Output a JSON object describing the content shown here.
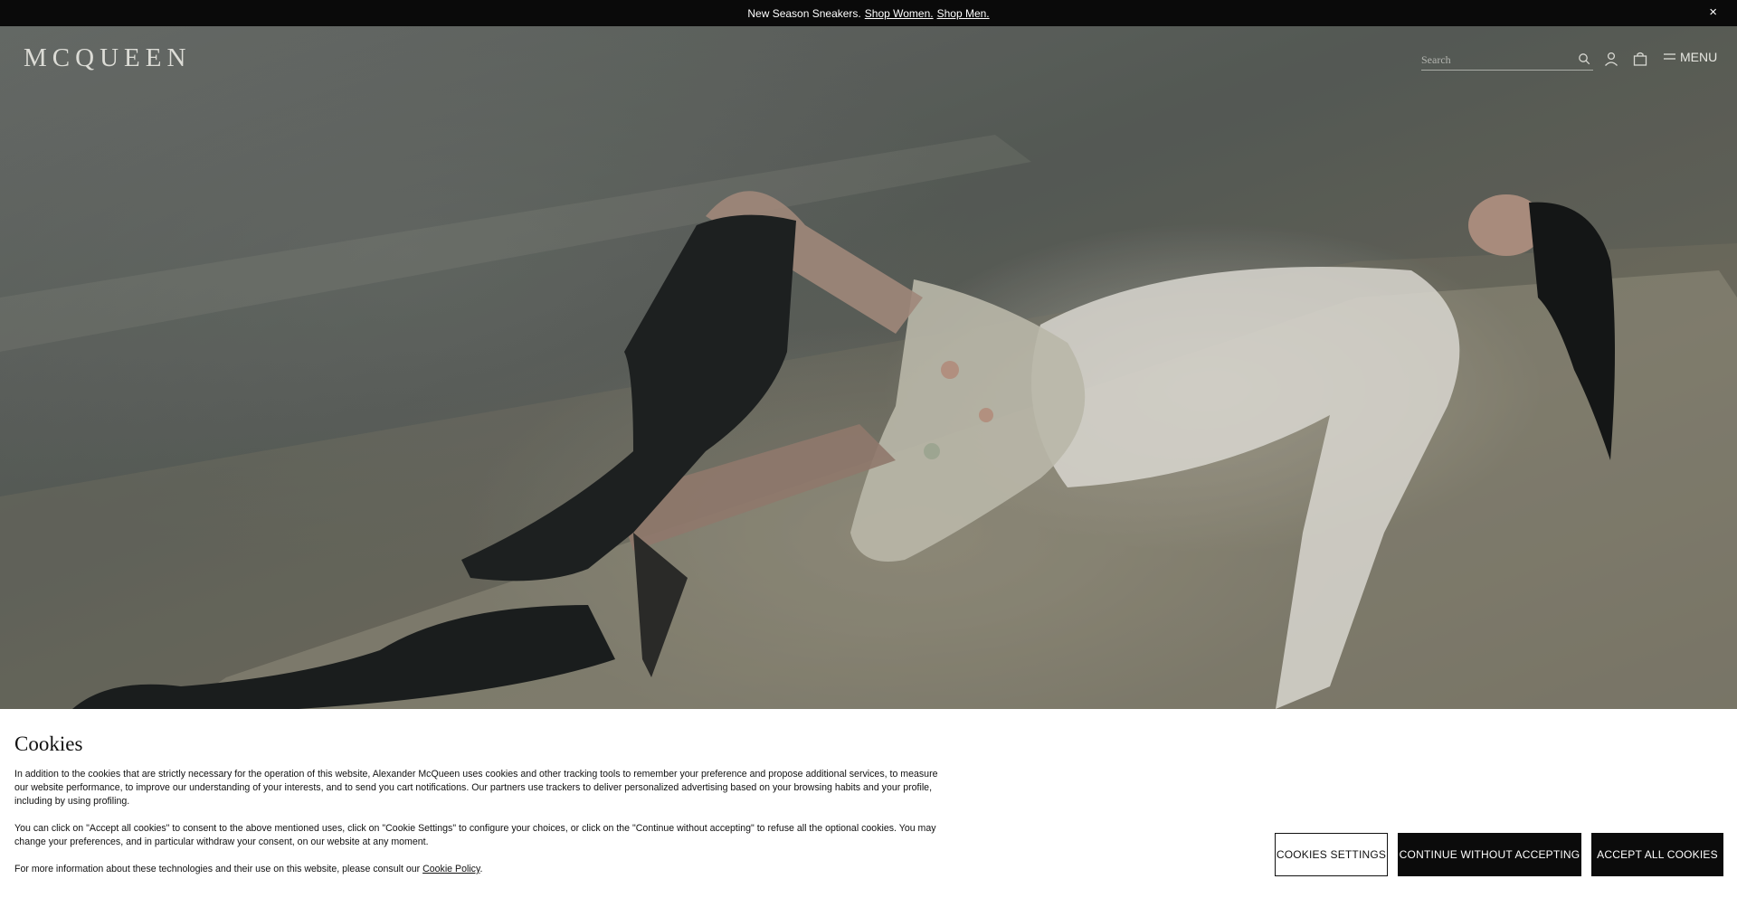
{
  "announcement": {
    "text": "New Season Sneakers.",
    "link_women": "Shop Women.",
    "link_men": "Shop Men.",
    "close": "×"
  },
  "header": {
    "logo": "MCQUEEN",
    "search_placeholder": "Search",
    "menu_label": "MENU"
  },
  "icons": {
    "search": "search-icon",
    "account": "user-icon",
    "bag": "bag-icon",
    "menu": "hamburger-icon",
    "close": "close-icon"
  },
  "cookies": {
    "title": "Cookies",
    "paragraph1": "In addition to the cookies that are strictly necessary for the operation of this website, Alexander McQueen uses cookies and other tracking tools to remember your preference and propose additional services, to measure our website performance, to improve our understanding of your interests, and to send you cart notifications. Our partners use trackers to deliver personalized advertising based on your browsing habits and your profile, including by using profiling.",
    "paragraph2": "You can click on \"Accept all cookies\" to consent to the above mentioned uses, click on \"Cookie Settings\" to configure your choices, or click on the \"Continue without accepting\" to refuse all the optional cookies. You may change your preferences, and in particular withdraw your consent, on our website at any moment.",
    "paragraph3": "For more information about these technologies and their use on this website, please consult our",
    "policy_link": "Cookie Policy",
    "period": ".",
    "settings_button": "COOKIES SETTINGS",
    "continue_button": "CONTINUE WITHOUT ACCEPTING",
    "accept_button": "ACCEPT ALL COOKIES"
  },
  "colors": {
    "announcement_bg": "#0a0a0a",
    "banner_bg": "#ffffff",
    "button_dark": "#0b0b0b"
  }
}
